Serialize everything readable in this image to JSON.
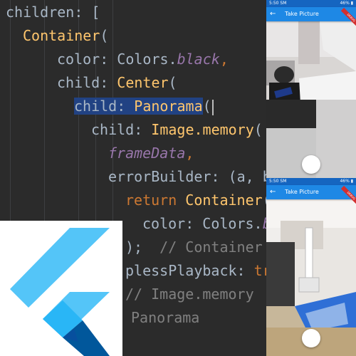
{
  "editor": {
    "lines": [
      {
        "segments": [
          {
            "t": "children: [",
            "c": "ident"
          }
        ]
      },
      {
        "segments": [
          {
            "t": "Container",
            "c": "cls"
          },
          {
            "t": "(",
            "c": "ident"
          }
        ]
      },
      {
        "segments": [
          {
            "t": "color: ",
            "c": "ident"
          },
          {
            "t": "Colors.",
            "c": "ident"
          },
          {
            "t": "black",
            "c": "ital"
          },
          {
            "t": ",",
            "c": "key"
          }
        ]
      },
      {
        "segments": [
          {
            "t": "child: ",
            "c": "ident"
          },
          {
            "t": "Center",
            "c": "cls"
          },
          {
            "t": "(",
            "c": "ident"
          }
        ]
      },
      {
        "segments": [
          {
            "t": "child: ",
            "c": "ident sel"
          },
          {
            "t": "Panorama",
            "c": "cls sel"
          },
          {
            "t": "(",
            "c": "ident"
          }
        ]
      },
      {
        "segments": [
          {
            "t": "child: ",
            "c": "ident"
          },
          {
            "t": "Image.memory",
            "c": "cls"
          },
          {
            "t": "(",
            "c": "ident"
          }
        ]
      },
      {
        "segments": [
          {
            "t": "frameData",
            "c": "ital"
          },
          {
            "t": ",",
            "c": "key"
          }
        ]
      },
      {
        "segments": [
          {
            "t": "errorBuilder: (a, b",
            "c": "ident"
          }
        ]
      },
      {
        "segments": [
          {
            "t": "return ",
            "c": "key"
          },
          {
            "t": "Container",
            "c": "cls"
          },
          {
            "t": "(",
            "c": "ident"
          }
        ]
      },
      {
        "segments": [
          {
            "t": "color: Colors.",
            "c": "ident"
          },
          {
            "t": "b",
            "c": "ital"
          }
        ]
      },
      {
        "segments": [
          {
            "t": ");  ",
            "c": "ident"
          },
          {
            "t": "// Container",
            "c": "cmt"
          }
        ]
      },
      {
        "segments": [
          {
            "t": "plessPlayback: ",
            "c": "ident"
          },
          {
            "t": "tr",
            "c": "key"
          }
        ]
      },
      {
        "segments": [
          {
            "t": "// Image.memory",
            "c": "cmt"
          }
        ]
      },
      {
        "segments": [
          {
            "t": "Panorama",
            "c": "cmt"
          }
        ]
      }
    ]
  },
  "phones": [
    {
      "status_time": "5:50 SM",
      "status_right": "46% ▮",
      "title": "Take Picture",
      "debug_banner": "DEBUG"
    },
    {
      "status_time": "5:50 SM",
      "status_right": "46% ▮",
      "title": "Take Picture",
      "debug_banner": "DEBUG"
    }
  ],
  "icons": {
    "back": "←",
    "logo": "flutter-logo",
    "shutter": "shutter-button"
  },
  "colors": {
    "flutter_light": "#54c5f8",
    "flutter_mid": "#29b6f6",
    "flutter_dark": "#01579b",
    "appbar": "#1e88e5"
  }
}
